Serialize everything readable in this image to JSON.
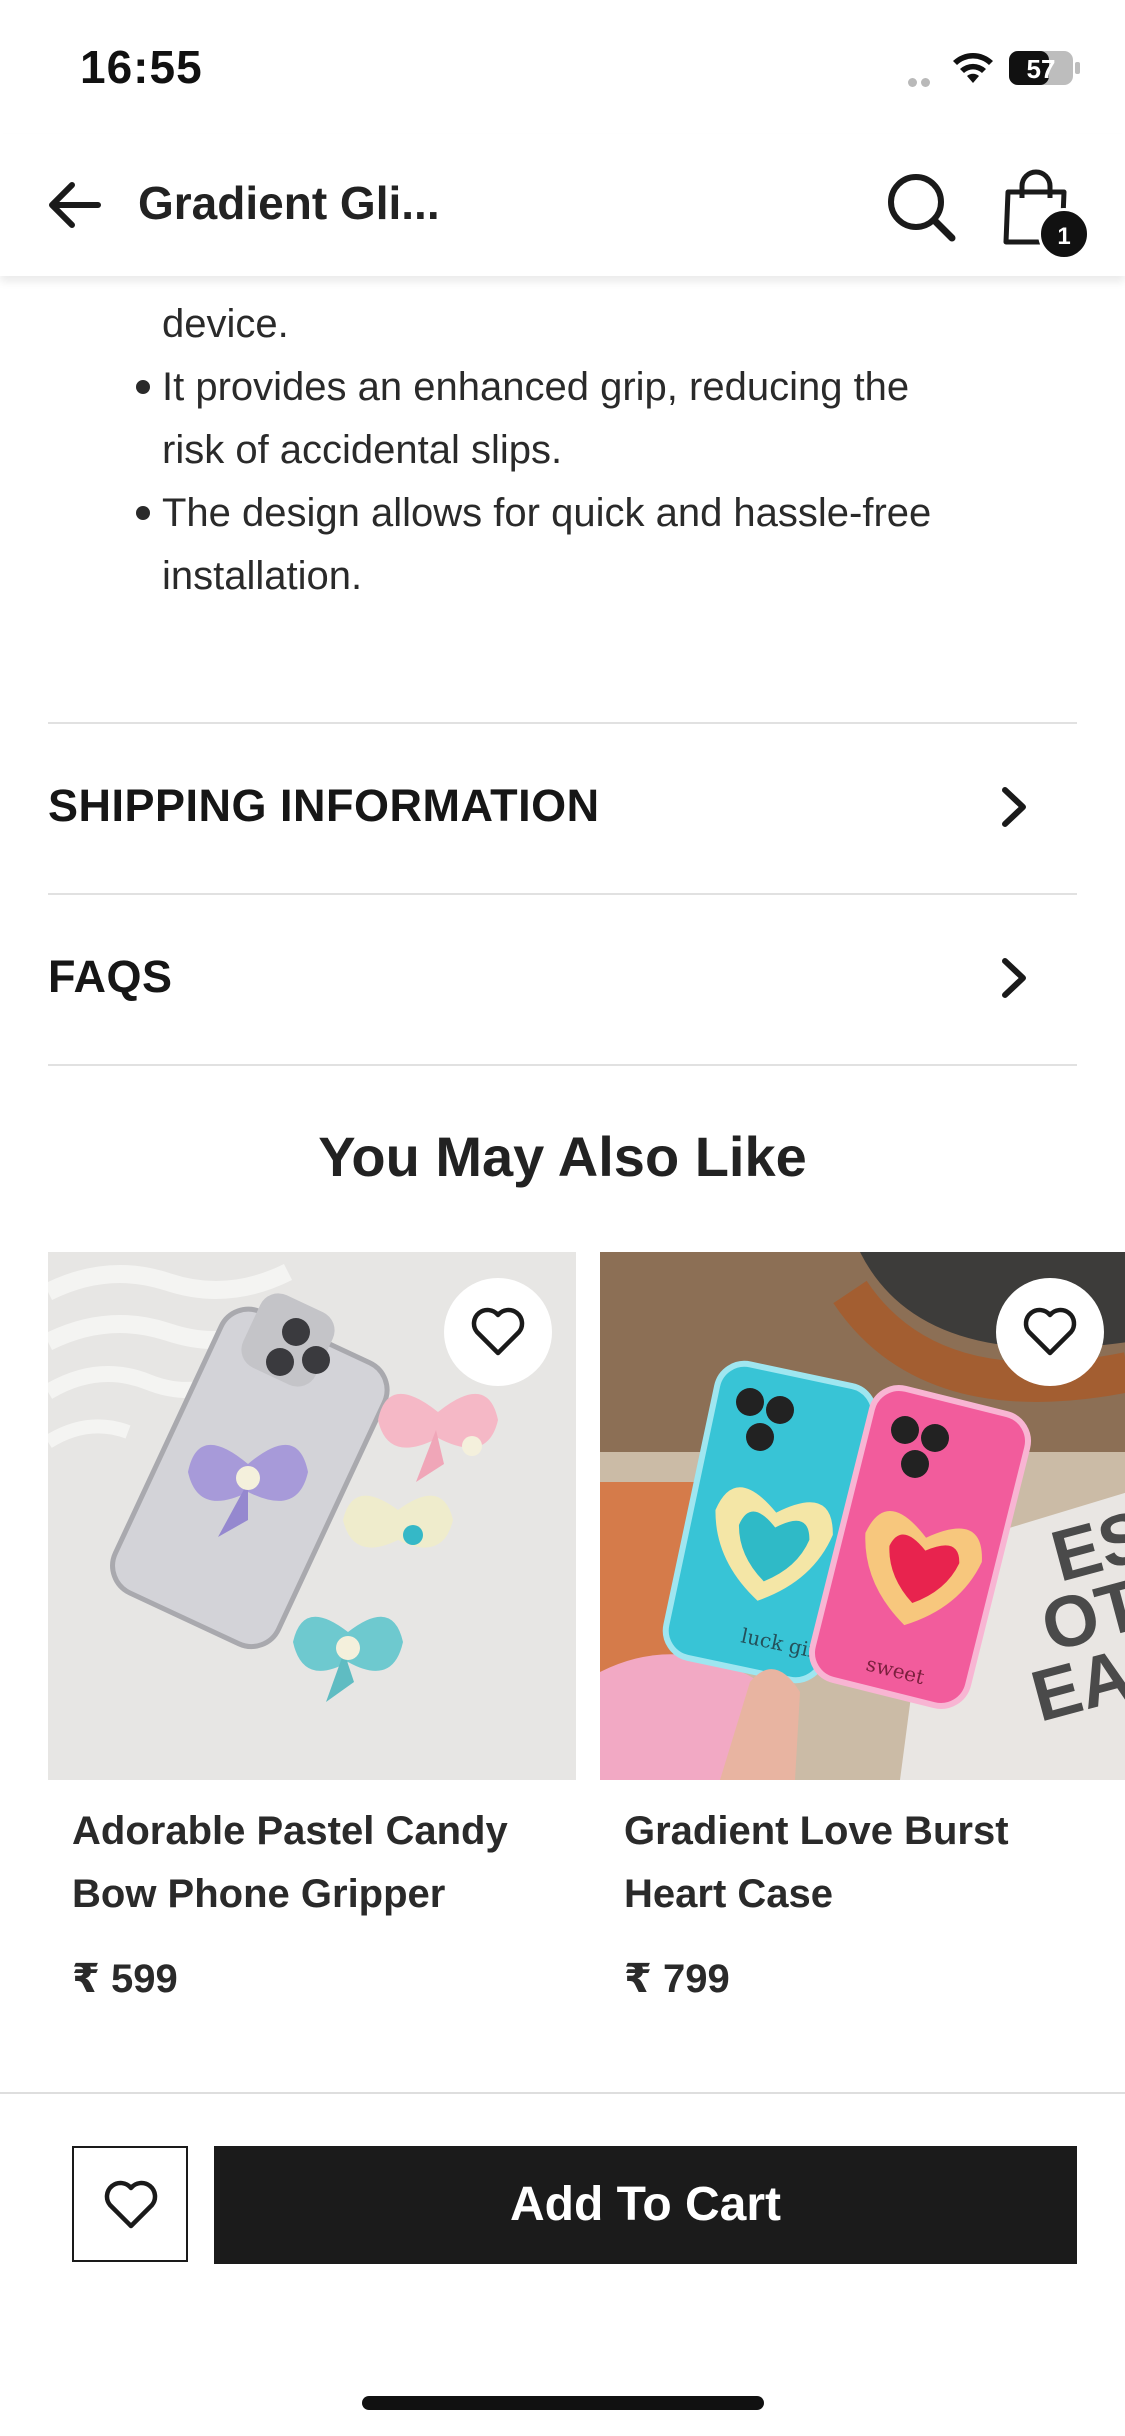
{
  "status_bar": {
    "time": "16:55",
    "battery": "57"
  },
  "header": {
    "title": "Gradient Gli...",
    "cart_count": "1"
  },
  "description": {
    "bullets": [
      {
        "lines": [
          "device."
        ]
      },
      {
        "lines": [
          "It provides an enhanced grip, reducing the",
          "risk of accidental slips."
        ]
      },
      {
        "lines": [
          "The design allows for quick and hassle-free",
          "installation."
        ]
      }
    ]
  },
  "accordion": {
    "items": [
      {
        "label": "SHIPPING INFORMATION"
      },
      {
        "label": "FAQS"
      }
    ]
  },
  "recommendations": {
    "title": "You May Also Like",
    "products": [
      {
        "name": "Adorable Pastel Candy Bow Phone Gripper",
        "price": "₹ 599",
        "image_desc": "clear-phone-with-pastel-bow-grippers"
      },
      {
        "name": "Gradient Love Burst Heart Case",
        "price": "₹ 799",
        "image_desc": "two-phones-with-heart-cases",
        "case_text_1": "luck girl",
        "case_text_2": "sweet"
      }
    ]
  },
  "bottom_bar": {
    "add_to_cart_label": "Add To Cart"
  },
  "icons": {
    "back": "arrow-left-icon",
    "search": "search-icon",
    "bag": "shopping-bag-icon",
    "wishlist": "heart-icon",
    "chevron": "chevron-right-icon"
  },
  "colors": {
    "primary": "#1b1b1b",
    "text": "#2a2a2a",
    "divider": "#e1e1e1",
    "background": "#ffffff"
  }
}
